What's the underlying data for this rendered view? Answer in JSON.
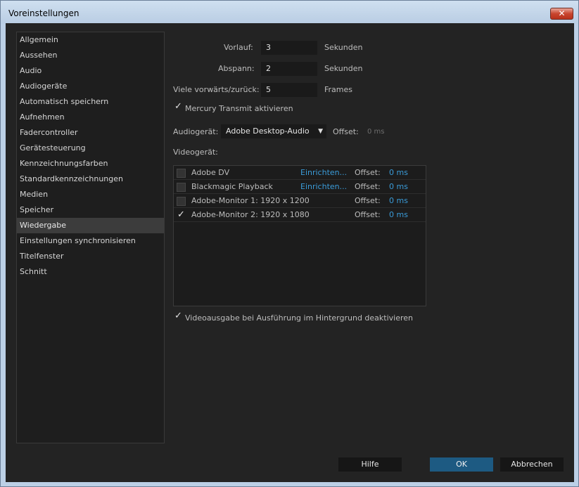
{
  "window": {
    "title": "Voreinstellungen",
    "close_glyph": "✕"
  },
  "sidebar": {
    "items": [
      {
        "label": "Allgemein"
      },
      {
        "label": "Aussehen"
      },
      {
        "label": "Audio"
      },
      {
        "label": "Audiogeräte"
      },
      {
        "label": "Automatisch speichern"
      },
      {
        "label": "Aufnehmen"
      },
      {
        "label": "Fadercontroller"
      },
      {
        "label": "Gerätesteuerung"
      },
      {
        "label": "Kennzeichnungsfarben"
      },
      {
        "label": "Standardkennzeichnungen"
      },
      {
        "label": "Medien"
      },
      {
        "label": "Speicher"
      },
      {
        "label": "Wiedergabe"
      },
      {
        "label": "Einstellungen synchronisieren"
      },
      {
        "label": "Titelfenster"
      },
      {
        "label": "Schnitt"
      }
    ],
    "selected": "Wiedergabe"
  },
  "playback": {
    "preroll": {
      "label": "Vorlauf:",
      "value": "3",
      "unit": "Sekunden"
    },
    "postroll": {
      "label": "Abspann:",
      "value": "2",
      "unit": "Sekunden"
    },
    "step": {
      "label": "Viele vorwärts/zurück:",
      "value": "5",
      "unit": "Frames"
    },
    "mercury": {
      "label": "Mercury Transmit aktivieren",
      "checked": true,
      "glyph": "✓"
    },
    "audio_device": {
      "label": "Audiogerät:",
      "value": "Adobe Desktop-Audio",
      "arrow": "▼",
      "offset_label": "Offset:",
      "offset_value": "0 ms"
    },
    "video_device_label": "Videogerät:",
    "video_devices": [
      {
        "name": "Adobe DV",
        "checked": false,
        "check_glyph": "",
        "setup": "Einrichten...",
        "offset_label": "Offset:",
        "offset_value": "0 ms"
      },
      {
        "name": "Blackmagic Playback",
        "checked": false,
        "check_glyph": "",
        "setup": "Einrichten...",
        "offset_label": "Offset:",
        "offset_value": "0 ms"
      },
      {
        "name": "Adobe-Monitor 1: 1920 x 1200",
        "checked": false,
        "check_glyph": "",
        "setup": "",
        "offset_label": "Offset:",
        "offset_value": "0 ms"
      },
      {
        "name": "Adobe-Monitor 2: 1920 x 1080",
        "checked": true,
        "check_glyph": "✓",
        "setup": "",
        "offset_label": "Offset:",
        "offset_value": "0 ms"
      }
    ],
    "background_disable": {
      "label": "Videoausgabe bei Ausführung im Hintergrund deaktivieren",
      "checked": true,
      "glyph": "✓"
    }
  },
  "buttons": {
    "help": "Hilfe",
    "ok": "OK",
    "cancel": "Abbrechen"
  },
  "colors": {
    "accent": "#1d5a82",
    "link": "#3a9bd8",
    "background": "#232323"
  }
}
